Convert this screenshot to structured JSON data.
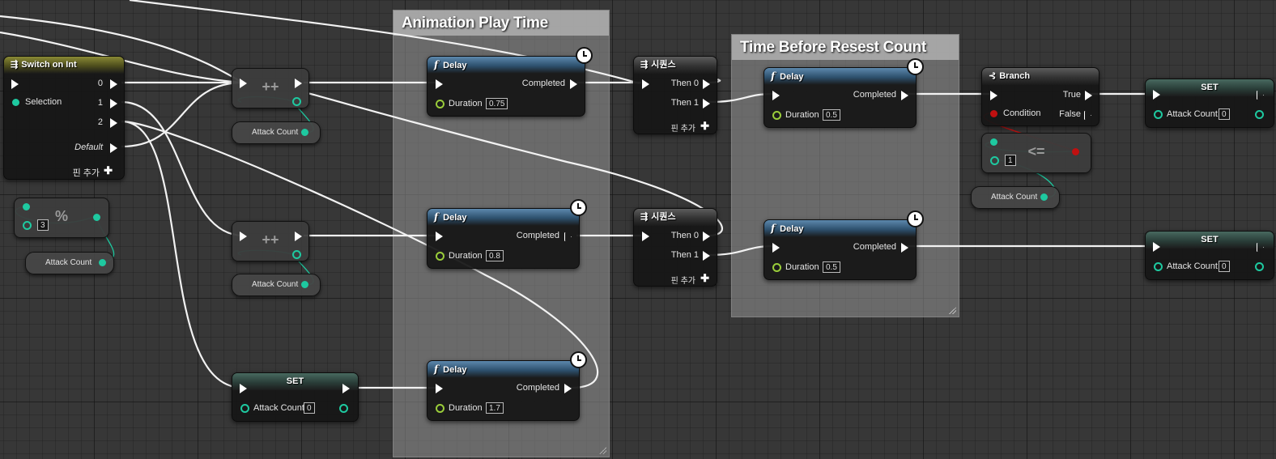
{
  "comments": {
    "animation": "Animation Play Time",
    "reset": "Time Before Resest Count"
  },
  "switch_node": {
    "title": "Switch on Int",
    "selection": "Selection",
    "out0": "0",
    "out1": "1",
    "out2": "2",
    "default": "Default",
    "add_pin": "핀 추가"
  },
  "modulo": {
    "symbol": "%",
    "value": "3"
  },
  "attack_count": "Attack Count",
  "increment_symbol": "++",
  "lte": {
    "symbol": "<=",
    "value": "1"
  },
  "delays": [
    {
      "title": "Delay",
      "completed": "Completed",
      "duration_label": "Duration",
      "duration": "0.75"
    },
    {
      "title": "Delay",
      "completed": "Completed",
      "duration_label": "Duration",
      "duration": "0.8"
    },
    {
      "title": "Delay",
      "completed": "Completed",
      "duration_label": "Duration",
      "duration": "1.7"
    },
    {
      "title": "Delay",
      "completed": "Completed",
      "duration_label": "Duration",
      "duration": "0.5"
    },
    {
      "title": "Delay",
      "completed": "Completed",
      "duration_label": "Duration",
      "duration": "0.5"
    }
  ],
  "sequences": [
    {
      "title": "시퀀스",
      "then0": "Then 0",
      "then1": "Then 1",
      "add_pin": "핀 추가"
    },
    {
      "title": "시퀀스",
      "then0": "Then 0",
      "then1": "Then 1",
      "add_pin": "핀 추가"
    }
  ],
  "branch": {
    "title": "Branch",
    "condition": "Condition",
    "true": "True",
    "false": "False"
  },
  "set_nodes": [
    {
      "title": "SET",
      "label": "Attack Count",
      "value": "0"
    },
    {
      "title": "SET",
      "label": "Attack Count",
      "value": "0"
    },
    {
      "title": "SET",
      "label": "Attack Count",
      "value": "0"
    }
  ],
  "colors": {
    "exec": "#ffffff",
    "int_pin": "#1ec9a0",
    "bool_pin": "#c01010",
    "float_pin": "#9acd3a",
    "function_header": "#2d506d",
    "switch_header": "#4d4d1c"
  },
  "icons": [
    "switch-icon",
    "function-icon",
    "clock-icon",
    "sequence-icon",
    "branch-icon",
    "exec-pin-icon",
    "data-pin-icon",
    "plus-icon"
  ]
}
